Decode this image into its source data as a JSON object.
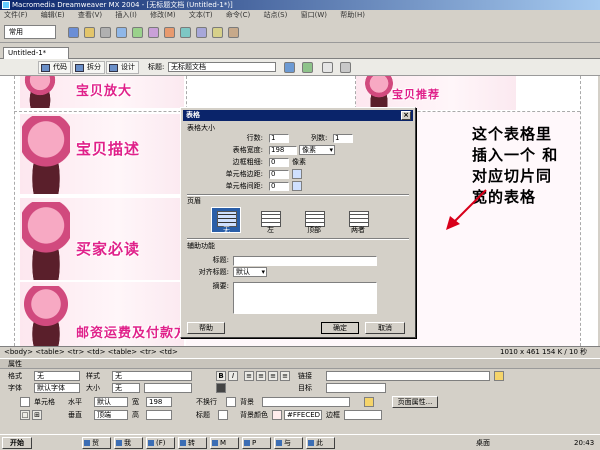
{
  "window": {
    "title": "Macromedia Dreamweaver MX 2004 - [无标题文档 (Untitled-1*)]"
  },
  "menu": [
    "文件(F)",
    "编辑(E)",
    "查看(V)",
    "插入(I)",
    "修改(M)",
    "文本(T)",
    "命令(C)",
    "站点(S)",
    "窗口(W)",
    "帮助(H)"
  ],
  "insertbar": {
    "category": "常用"
  },
  "document": {
    "tab": "Untitled-1*",
    "views": [
      "代码",
      "拆分",
      "设计"
    ],
    "title_label": "标题:",
    "title_value": "无标题文档"
  },
  "canvas": {
    "captions": [
      "宝贝描述",
      "买家必读",
      "邮资运费及付款方式",
      "宝贝推荐"
    ],
    "top_caption": "宝贝放大",
    "note": [
      "这个表格里",
      "插入一个 和",
      "对应切片同",
      "宽的表格"
    ]
  },
  "dialog": {
    "title": "表格",
    "section_size": "表格大小",
    "rows_label": "行数:",
    "rows_value": "1",
    "cols_label": "列数:",
    "cols_value": "1",
    "width_label": "表格宽度:",
    "width_value": "198",
    "width_unit": "像素",
    "border_label": "边框粗细:",
    "border_value": "0",
    "border_unit": "像素",
    "padding_label": "单元格边距:",
    "padding_value": "0",
    "spacing_label": "单元格间距:",
    "spacing_value": "0",
    "section_header": "页眉",
    "headers": [
      "无",
      "左",
      "顶部",
      "两者"
    ],
    "section_access": "辅助功能",
    "caption_label": "标题:",
    "align_label": "对齐标题:",
    "align_value": "默认",
    "summary_label": "摘要:",
    "help_btn": "帮助",
    "ok_btn": "确定",
    "cancel_btn": "取消"
  },
  "statusbar": {
    "tags": "<body> <table> <tr> <td> <table> <tr> <td>",
    "size": "1010 x 461",
    "weight": "154 K / 10 秒"
  },
  "properties": {
    "title": "属性",
    "format_label": "格式",
    "format_value": "无",
    "style_label": "样式",
    "style_value": "无",
    "font_label": "字体",
    "font_value": "默认字体",
    "size_label": "大小",
    "size_value": "无",
    "link_label": "链接",
    "target_label": "目标",
    "cell_label": "单元格",
    "halign_label": "水平",
    "halign_value": "默认",
    "valign_label": "垂直",
    "valign_value": "顶端",
    "width_label": "宽",
    "width_value": "198",
    "height_label": "高",
    "nowrap_label": "不换行",
    "bg_label": "背景",
    "header_label": "标题",
    "bgcolor_label": "背景颜色",
    "bgcolor_value": "#FFECED",
    "border_label": "边框",
    "page_props_btn": "页面属性..."
  },
  "taskbar": {
    "start": "开始",
    "apps": [
      "贸",
      "我",
      "(F)",
      "转",
      "M",
      "P",
      "与",
      "此"
    ],
    "desktop": "桌面",
    "clock": "20:43"
  },
  "colors": {
    "accent": "#e0218a",
    "dialog_title": "#0a246a",
    "note_text": "#ffffff"
  }
}
